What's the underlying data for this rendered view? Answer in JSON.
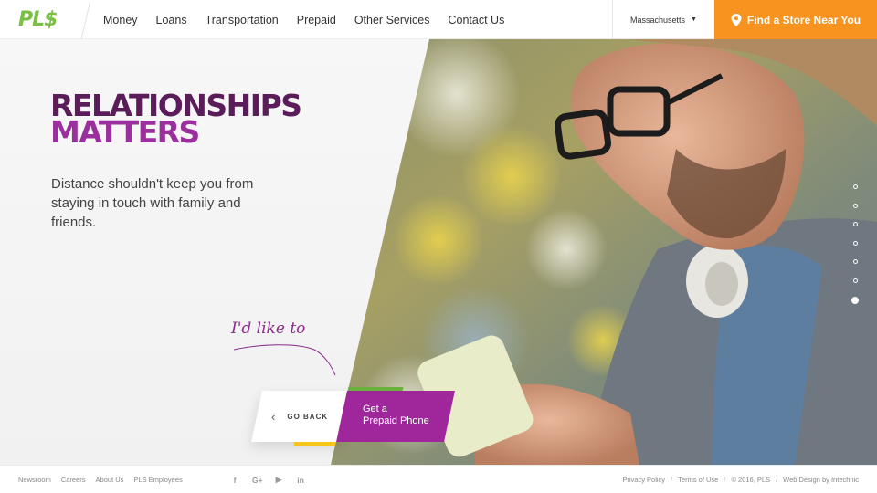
{
  "header": {
    "logo": "PL$",
    "nav": [
      "Money",
      "Loans",
      "Transportation",
      "Prepaid",
      "Other Services",
      "Contact Us"
    ],
    "region": "Massachusetts",
    "find_store": "Find a Store Near You"
  },
  "hero": {
    "headline_line1": "RELATIONSHIPS",
    "headline_line2": "MATTERS",
    "subtext": "Distance shouldn't keep you from staying in touch with family and friends.",
    "script_label": "I'd like to",
    "go_back": "GO BACK",
    "cta_line1": "Get a",
    "cta_line2": "Prepaid Phone",
    "slide_count": 7,
    "active_slide": 7
  },
  "footer": {
    "links": [
      "Newsroom",
      "Careers",
      "About Us",
      "PLS Employees"
    ],
    "social_icons": [
      "facebook-icon",
      "google-plus-icon",
      "youtube-icon",
      "linkedin-icon"
    ],
    "social_glyphs": [
      "f",
      "G+",
      "▶",
      "in"
    ],
    "privacy": "Privacy Policy",
    "terms": "Terms of Use",
    "copyright": "© 2016, PLS",
    "credit": "Web Design by Intechnic"
  },
  "colors": {
    "brand_green": "#7ac043",
    "accent_orange": "#f7931e",
    "purple_dark": "#5b1c5a",
    "purple": "#a0269b"
  }
}
